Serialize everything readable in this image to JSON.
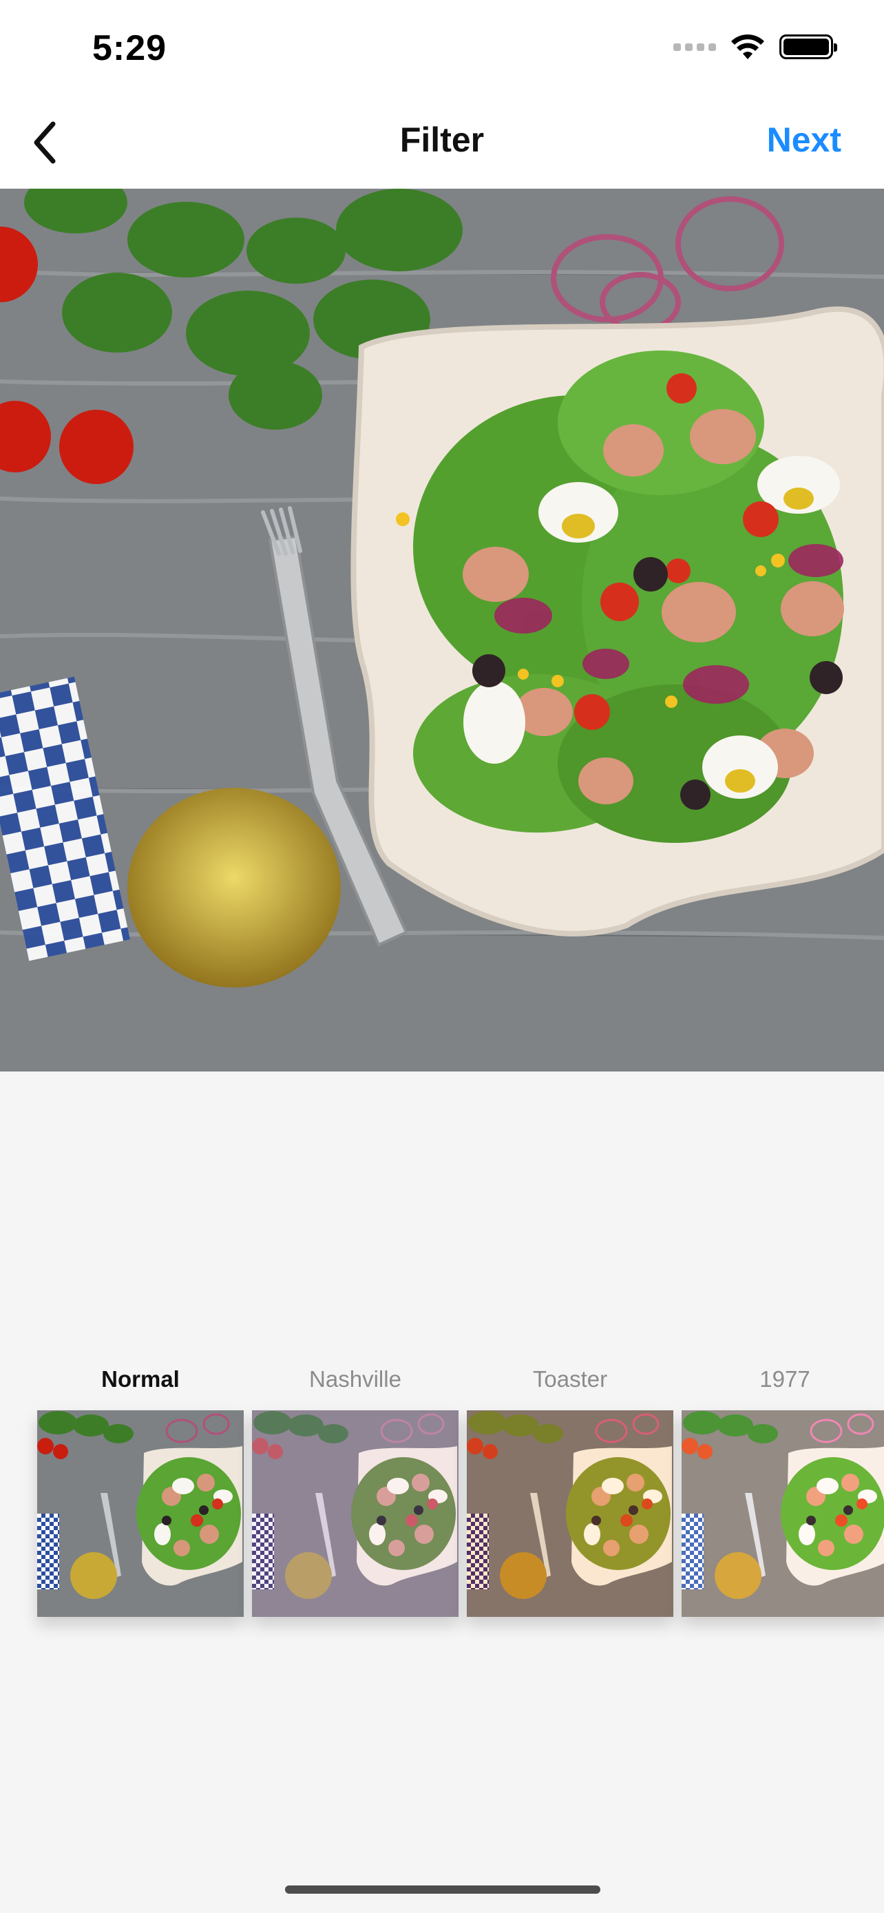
{
  "status_bar": {
    "time": "5:29",
    "icons": [
      "cellular-signal-icon",
      "wifi-icon",
      "battery-icon"
    ]
  },
  "nav": {
    "back_icon": "chevron-left-icon",
    "title": "Filter",
    "next_label": "Next",
    "next_color": "#1a8cff"
  },
  "preview": {
    "image": "salad-photo"
  },
  "filters": [
    {
      "label": "Normal",
      "selected": true
    },
    {
      "label": "Nashville",
      "selected": false
    },
    {
      "label": "Toaster",
      "selected": false
    },
    {
      "label": "1977",
      "selected": false
    }
  ]
}
